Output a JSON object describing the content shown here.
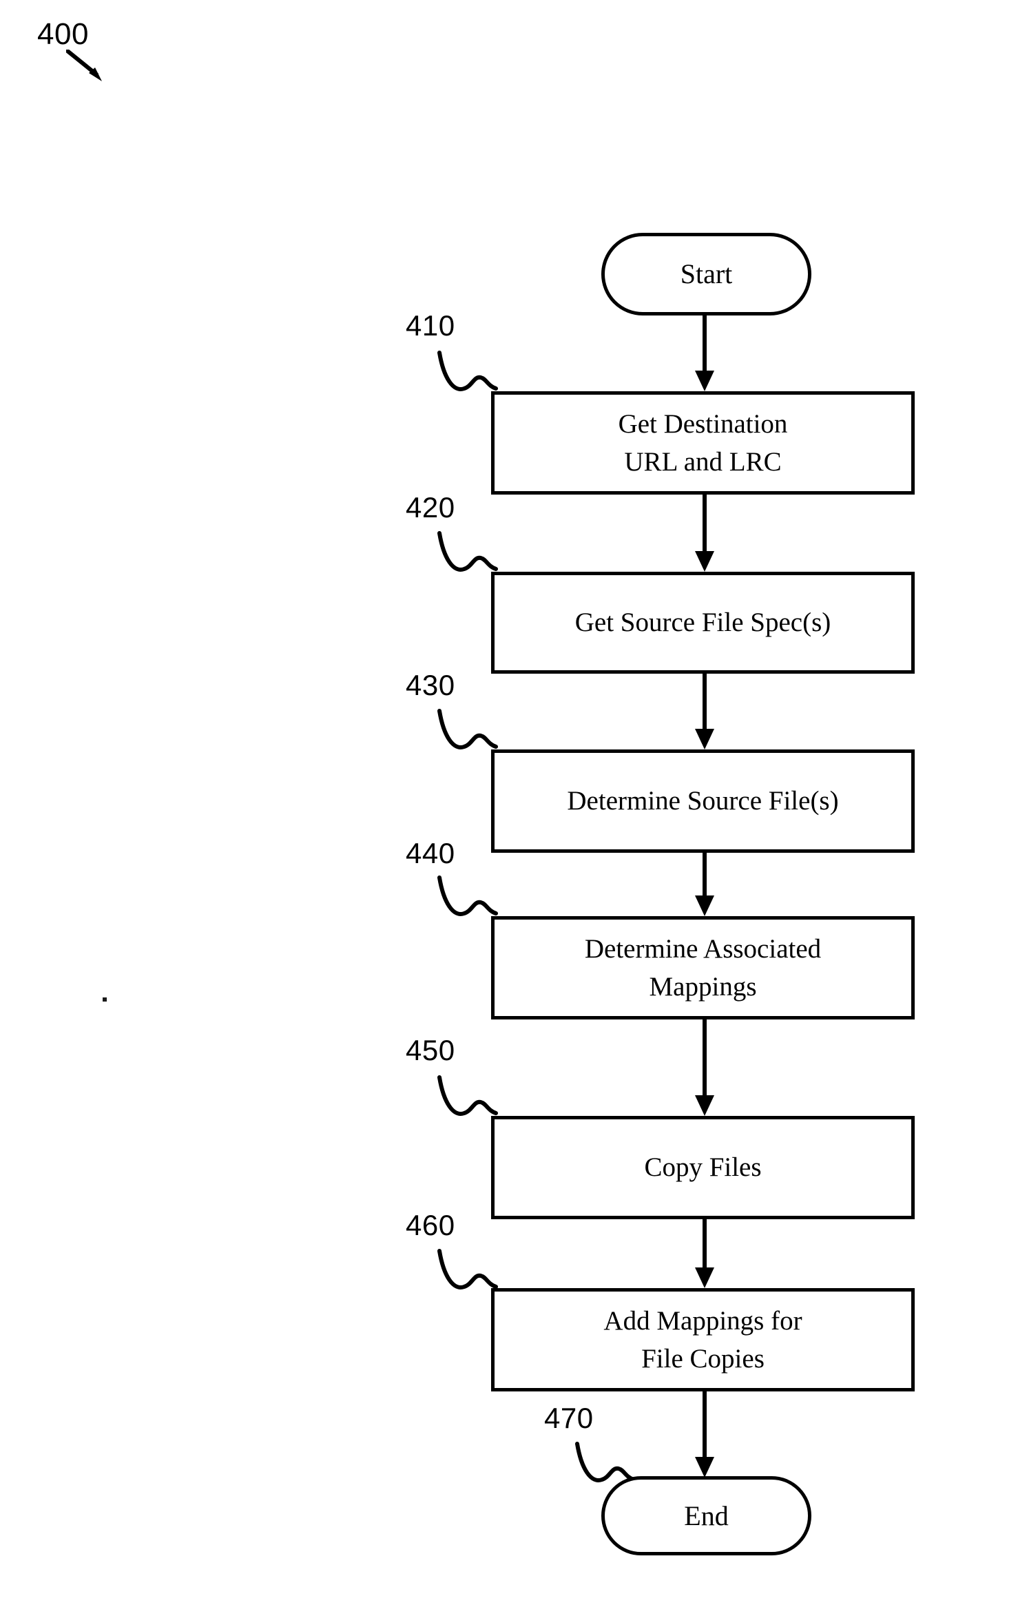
{
  "figure": {
    "number": "400",
    "arrow_icon": "diagonal-arrow-icon"
  },
  "diagram": {
    "type": "flowchart",
    "orientation": "vertical",
    "line_color": "#000000",
    "background_color": "#ffffff",
    "nodes": [
      {
        "id": "start",
        "shape": "terminal",
        "label": "Start",
        "ref": ""
      },
      {
        "id": "n410",
        "shape": "process",
        "label": "Get Destination\nURL and LRC",
        "ref": "410"
      },
      {
        "id": "n420",
        "shape": "process",
        "label": "Get Source File Spec(s)",
        "ref": "420"
      },
      {
        "id": "n430",
        "shape": "process",
        "label": "Determine Source File(s)",
        "ref": "430"
      },
      {
        "id": "n440",
        "shape": "process",
        "label": "Determine Associated\nMappings",
        "ref": "440"
      },
      {
        "id": "n450",
        "shape": "process",
        "label": "Copy Files",
        "ref": "450"
      },
      {
        "id": "n460",
        "shape": "process",
        "label": "Add Mappings for\nFile Copies",
        "ref": "460"
      },
      {
        "id": "end",
        "shape": "terminal",
        "label": "End",
        "ref": "470"
      }
    ],
    "node_text": {
      "start": "Start",
      "n410_line1": "Get Destination",
      "n410_line2": "URL and LRC",
      "n420": "Get Source File Spec(s)",
      "n430": "Determine Source File(s)",
      "n440_line1": "Determine Associated",
      "n440_line2": "Mappings",
      "n450": "Copy Files",
      "n460_line1": "Add Mappings for",
      "n460_line2": "File Copies",
      "end": "End"
    },
    "refs": {
      "r410": "410",
      "r420": "420",
      "r430": "430",
      "r440": "440",
      "r450": "450",
      "r460": "460",
      "r470": "470"
    },
    "edges": [
      {
        "from": "start",
        "to": "n410",
        "arrowhead": true
      },
      {
        "from": "n410",
        "to": "n420",
        "arrowhead": true
      },
      {
        "from": "n420",
        "to": "n430",
        "arrowhead": true
      },
      {
        "from": "n430",
        "to": "n440",
        "arrowhead": true
      },
      {
        "from": "n440",
        "to": "n450",
        "arrowhead": true
      },
      {
        "from": "n450",
        "to": "n460",
        "arrowhead": true
      },
      {
        "from": "n460",
        "to": "end",
        "arrowhead": true
      }
    ]
  }
}
